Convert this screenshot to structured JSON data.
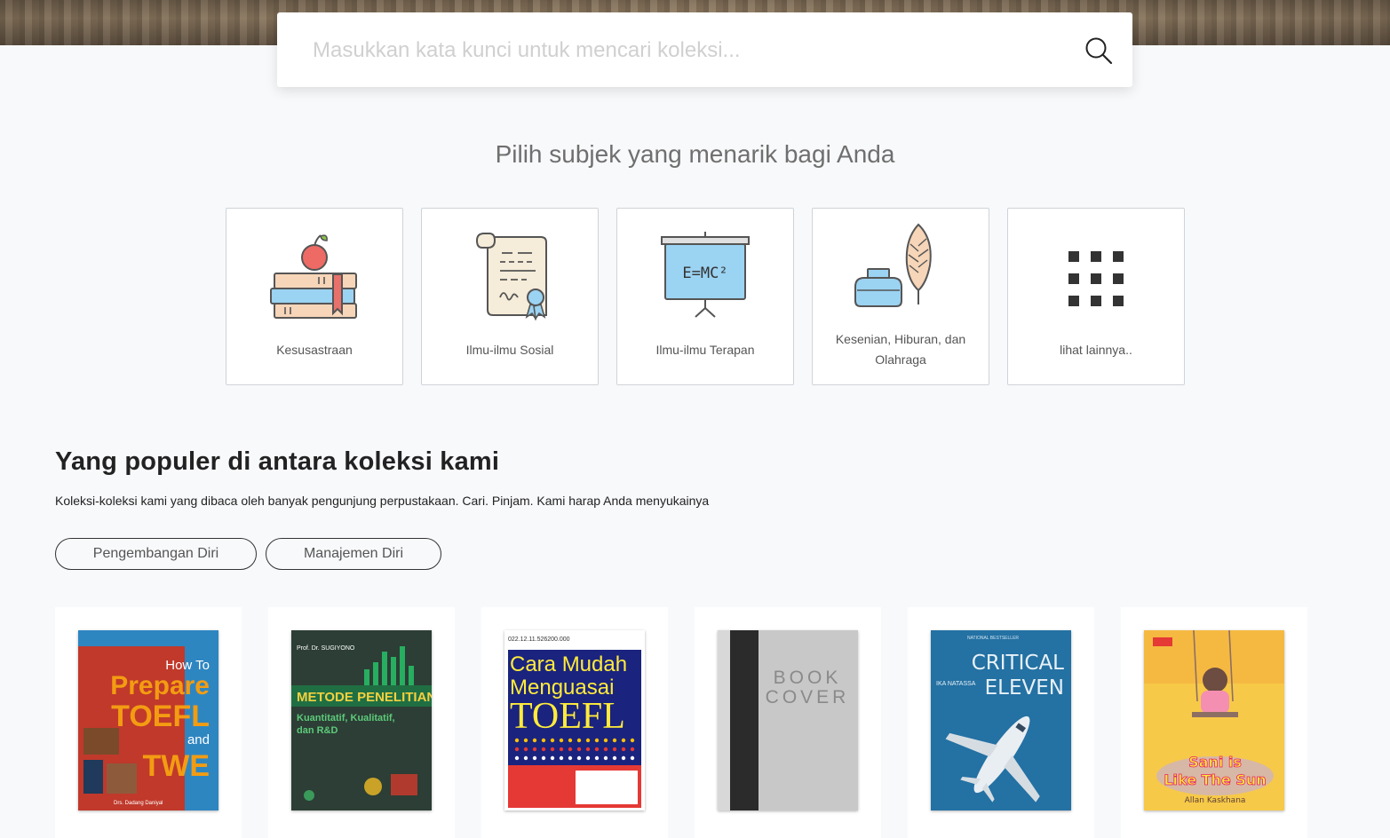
{
  "search": {
    "placeholder": "Masukkan kata kunci untuk mencari koleksi..."
  },
  "subjects": {
    "heading": "Pilih subjek yang menarik bagi Anda",
    "items": [
      {
        "label": "Kesusastraan",
        "icon": "books-apple-icon"
      },
      {
        "label": "Ilmu-ilmu Sosial",
        "icon": "scroll-certificate-icon"
      },
      {
        "label": "Ilmu-ilmu Terapan",
        "icon": "presentation-board-icon"
      },
      {
        "label": "Kesenian, Hiburan, dan Olahraga",
        "icon": "ink-feather-icon"
      },
      {
        "label": "lihat lainnya..",
        "icon": "grid-icon"
      }
    ]
  },
  "popular": {
    "title": "Yang populer di antara koleksi kami",
    "description": "Koleksi-koleksi kami yang dibaca oleh banyak pengunjung perpustakaan. Cari. Pinjam. Kami harap Anda menyukainya",
    "filters": [
      "Pengembangan Diri",
      "Manajemen Diri"
    ]
  },
  "books": [
    {
      "cover_lines": [
        "How To",
        "Prepare",
        "TOEFL",
        "and",
        "TWE"
      ],
      "author": "Drs. Dadang Daniyal",
      "colors": {
        "bg": "#c0392b",
        "band": "#2e86c1",
        "text": "#f39c12"
      }
    },
    {
      "author": "Prof. Dr. SUGIYONO",
      "title": "METODE PENELITIAN",
      "subtitle_lines": [
        "Kuantitatif, Kualitatif,",
        "dan R&D"
      ],
      "colors": {
        "bg": "#2c3e35",
        "bars": "#27ae60",
        "title": "#f4d03f"
      }
    },
    {
      "catalog_number": "022.12.11.526200.000",
      "title_lines": [
        "Cara Mudah",
        "Menguasai",
        "TOEFL"
      ],
      "colors": {
        "bg": "#1a237e",
        "text": "#ffeb3b",
        "bottom": "#e53935"
      }
    },
    {
      "cover_lines": [
        "BOOK",
        "COVER"
      ],
      "colors": {
        "bg": "#c8c8c8",
        "spine": "#2b2b2b"
      }
    },
    {
      "badge": "NATIONAL BESTSELLER",
      "author": "IKA NATASSA",
      "title_lines": [
        "CRITICAL",
        "ELEVEN"
      ],
      "colors": {
        "bg": "#2471a3",
        "text": "#e8f1f8"
      }
    },
    {
      "title_lines": [
        "Sani is",
        "Like The Sun"
      ],
      "author": "Allan Kaskhana",
      "colors": {
        "bg": "#f7c948",
        "text": "#e91e63"
      }
    }
  ]
}
